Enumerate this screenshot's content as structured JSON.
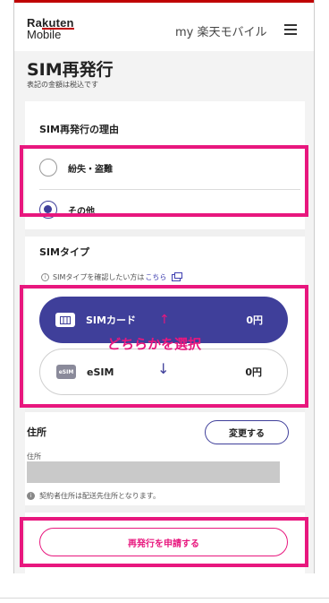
{
  "header": {
    "logo_line1_prefix": "Ra",
    "logo_line1_accent": "kuten",
    "logo_line2": "Mobile",
    "my_link": "my 楽天モバイル"
  },
  "page": {
    "title": "SIM再発行",
    "tax_note": "表記の金額は税込です"
  },
  "reason": {
    "title": "SIM再発行の理由",
    "options": [
      {
        "label": "紛失・盗難",
        "selected": false
      },
      {
        "label": "その他",
        "selected": true
      }
    ]
  },
  "sim_type": {
    "title": "SIMタイプ",
    "info_text": "SIMタイプを確認したい方は",
    "info_link": "こちら",
    "options": [
      {
        "icon_text": "",
        "label": "SIMカード",
        "price": "0円",
        "selected": true
      },
      {
        "icon_text": "eSIM",
        "label": "eSIM",
        "price": "0円",
        "selected": false
      }
    ]
  },
  "annotation": {
    "text": "どちらかを選択",
    "color": "#e8177e"
  },
  "address": {
    "title": "住所",
    "change_button": "変更する",
    "field_label": "住所",
    "note": "契約者住所は配送先住所となります。"
  },
  "submit_button": "再発行を申請する",
  "colors": {
    "brand_red": "#bf0000",
    "accent_navy": "#3f3f9a",
    "annotation_pink": "#e8177e"
  }
}
